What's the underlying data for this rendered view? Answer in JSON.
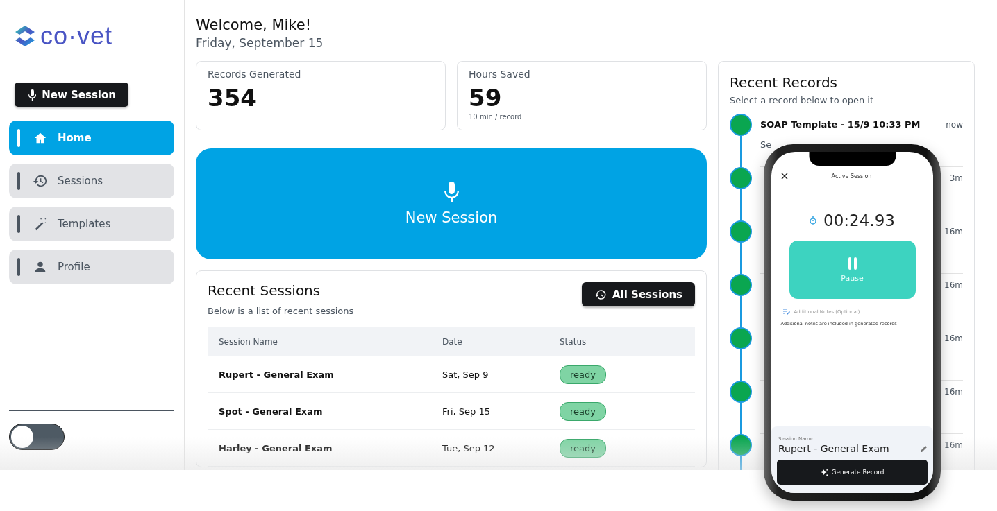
{
  "logo": {
    "text": "co·vet"
  },
  "sidebar": {
    "new_session_button": "New Session",
    "items": [
      {
        "label": "Home",
        "selected": true
      },
      {
        "label": "Sessions",
        "selected": false
      },
      {
        "label": "Templates",
        "selected": false
      },
      {
        "label": "Profile",
        "selected": false
      }
    ],
    "dark_mode_toggle": {
      "on": false
    }
  },
  "header": {
    "title": "Welcome, Mike!",
    "date": "Friday, September 15"
  },
  "stats": [
    {
      "label": "Records Generated",
      "value": "354"
    },
    {
      "label": "Hours Saved",
      "value": "59",
      "note": "10 min / record"
    }
  ],
  "new_session_card": {
    "label": "New Session"
  },
  "recent_sessions": {
    "title": "Recent Sessions",
    "subtitle": "Below is a list of recent sessions",
    "all_button": "All Sessions",
    "columns": [
      "Session Name",
      "Date",
      "Status"
    ],
    "rows": [
      {
        "name": "Rupert - General Exam",
        "date": "Sat, Sep 9",
        "status": "ready"
      },
      {
        "name": "Spot - General Exam",
        "date": "Fri, Sep 15",
        "status": "ready"
      },
      {
        "name": "Harley - General Exam",
        "date": "Tue, Sep 12",
        "status": "ready"
      }
    ]
  },
  "recent_records": {
    "title": "Recent Records",
    "subtitle": "Select a record below to open it",
    "items": [
      {
        "title": "SOAP Template - 15/9 10:33 PM",
        "subtitle": "Se",
        "time": "now"
      },
      {
        "time": "3m"
      },
      {
        "time": "16m"
      },
      {
        "time": "16m"
      },
      {
        "time": "16m"
      },
      {
        "time": "16m"
      },
      {
        "time": "16m"
      }
    ]
  },
  "phone": {
    "title": "Active Session",
    "timer": "00:24.93",
    "pause_button": "Pause",
    "notes_placeholder": "Additional Notes (Optional)",
    "notes_help": "Additional notes are included in generated records",
    "session_name_label": "Session Name",
    "session_name": "Rupert - General Exam",
    "generate_button": "Generate Record"
  }
}
